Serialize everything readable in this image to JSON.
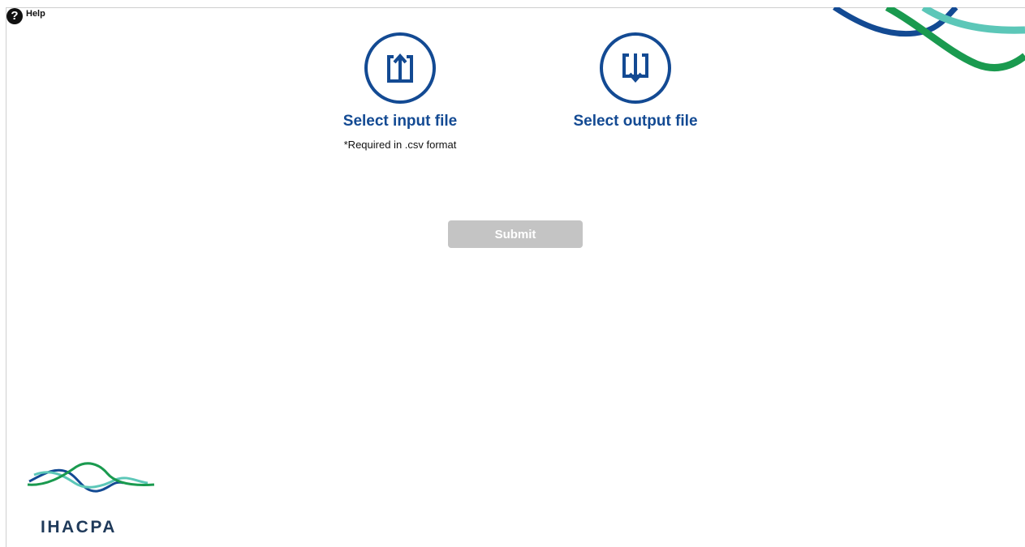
{
  "help": {
    "icon": "question-circle-icon",
    "label": "Help"
  },
  "input_file": {
    "icon": "upload-file-icon",
    "title": "Select input file",
    "note": "*Required in .csv format"
  },
  "output_file": {
    "icon": "download-file-icon",
    "title": "Select output file"
  },
  "submit": {
    "label": "Submit",
    "state": "disabled"
  },
  "logo": {
    "text": "IHACPA"
  },
  "colors": {
    "primary_blue": "#134a93",
    "wave_dark_blue": "#134a93",
    "wave_green": "#1a9a4f",
    "wave_teal": "#5cc7b8",
    "submit_disabled": "#c4c4c4"
  }
}
